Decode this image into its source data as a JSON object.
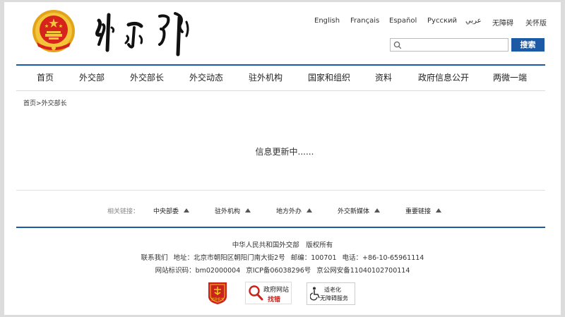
{
  "header": {
    "emblem_icon": "national-emblem-icon",
    "site_logo_icon": "ministry-calligraphy-logo-icon",
    "languages": [
      "English",
      "Français",
      "Español",
      "Русский",
      "عربي",
      "无障碍",
      "关怀版"
    ],
    "search": {
      "placeholder": "",
      "button_label": "搜索"
    }
  },
  "nav": {
    "items": [
      "首页",
      "外交部",
      "外交部长",
      "外交动态",
      "驻外机构",
      "国家和组织",
      "资料",
      "政府信息公开",
      "两微一端"
    ]
  },
  "breadcrumb": {
    "home": "首页",
    "separator": ">",
    "current": "外交部长"
  },
  "main": {
    "message": "信息更新中......"
  },
  "related_links": {
    "label": "相关链接：",
    "items": [
      "中央部委",
      "驻外机构",
      "地方外办",
      "外交新媒体",
      "重要链接"
    ]
  },
  "footer": {
    "copyright": "中华人民共和国外交部　版权所有",
    "contact": "联系我们",
    "address": "地址：北京市朝阳区朝阳门南大街2号",
    "postcode": "邮编：100701",
    "phone": "电话：+86-10-65961114",
    "site_code": "网站标识码：bm02000004",
    "icp": "京ICP备06038296号",
    "police": "京公网安备11040102700114",
    "badges": {
      "party_org_label": "党政机关",
      "gov_site_line1": "政府网站",
      "gov_site_line2": "找错",
      "accessibility_line1": "适老化",
      "accessibility_line2": "无障碍服务"
    }
  },
  "colors": {
    "accent": "#1c5aa6",
    "error_red": "#c9231b",
    "emblem_red": "#d6231c",
    "emblem_gold": "#f0c419"
  }
}
